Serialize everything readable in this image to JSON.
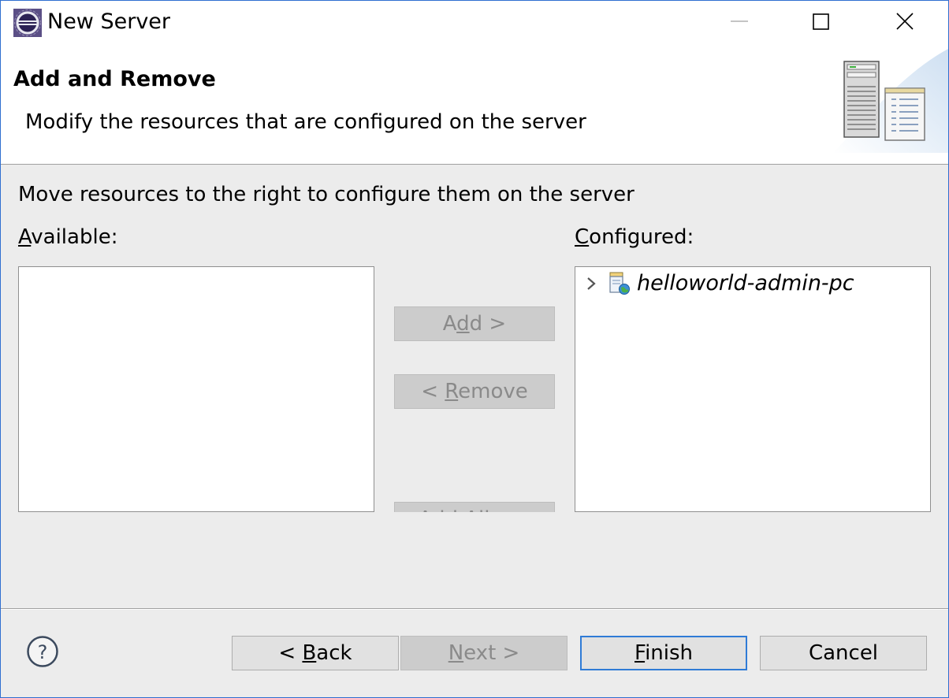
{
  "window": {
    "title": "New Server",
    "minimize_icon": "minimize-icon",
    "maximize_icon": "maximize-icon",
    "close_icon": "close-icon",
    "border_color": "#2f6fd0"
  },
  "header": {
    "heading": "Add and Remove",
    "description": "Modify the resources that are configured on the server",
    "graphic": "server-icon"
  },
  "body": {
    "instruction": "Move resources to the right to configure them on the server",
    "available": {
      "label_mnemonic": "A",
      "label_rest": "vailable:",
      "items": []
    },
    "configured": {
      "label_mnemonic": "C",
      "label_rest": "onfigured:",
      "items": [
        {
          "label": "helloworld-admin-pc",
          "icon": "web-module-icon",
          "expander": "chevron-right-icon"
        }
      ]
    },
    "add_button": {
      "pre": "A",
      "mnemonic": "d",
      "post": "d >"
    },
    "remove_button": {
      "pre": "< ",
      "mnemonic": "R",
      "post": "emove"
    },
    "add_all_button": {
      "label": "Add All >>"
    }
  },
  "footer": {
    "help_icon": "help-icon",
    "back_button": {
      "pre": "< ",
      "mnemonic": "B",
      "post": "ack"
    },
    "next_button": {
      "mnemonic": "N",
      "post": "ext >"
    },
    "finish_button": {
      "mnemonic": "F",
      "post": "inish"
    },
    "cancel_button": {
      "label": "Cancel"
    }
  },
  "colors": {
    "dialog_bg": "#ececec",
    "focus_border": "#2f7bd6",
    "disabled_text": "#8a8a8a"
  }
}
